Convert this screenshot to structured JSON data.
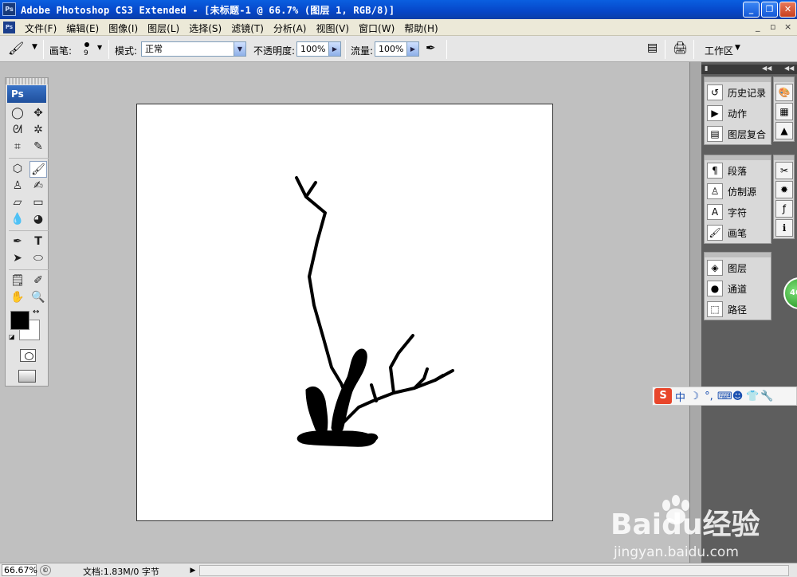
{
  "window": {
    "title": "Adobe Photoshop CS3 Extended - [未标题-1 @ 66.7% (图层 1, RGB/8)]",
    "app_icon": "Ps",
    "controls": [
      "minimize-icon",
      "restore-icon",
      "close-icon"
    ]
  },
  "menubar": {
    "doc_icon": "Ps",
    "items": [
      "文件(F)",
      "编辑(E)",
      "图像(I)",
      "图层(L)",
      "选择(S)",
      "滤镜(T)",
      "分析(A)",
      "视图(V)",
      "窗口(W)",
      "帮助(H)"
    ],
    "doc_controls": [
      "_",
      "▫",
      "×"
    ]
  },
  "options": {
    "brush_label": "画笔:",
    "brush_size": "9",
    "mode_label": "模式:",
    "mode_value": "正常",
    "opacity_label": "不透明度:",
    "opacity_value": "100%",
    "flow_label": "流量:",
    "flow_value": "100%",
    "workspace_label": "工作区"
  },
  "toolbox": {
    "badge": "Ps",
    "foreground_color": "#000000",
    "background_color": "#ffffff"
  },
  "panels": {
    "group1": [
      "历史记录",
      "动作",
      "图层复合"
    ],
    "group2": [
      "段落",
      "仿制源",
      "字符",
      "画笔"
    ],
    "group3": [
      "图层",
      "通道",
      "路径"
    ]
  },
  "ime": {
    "logo": "S",
    "mode": "中"
  },
  "side_badge": "46",
  "status": {
    "zoom": "66.67%",
    "doc_info": "文档:1.83M/0 字节"
  },
  "watermark": {
    "brand": "Baidu经验",
    "url": "jingyan.baidu.com"
  }
}
